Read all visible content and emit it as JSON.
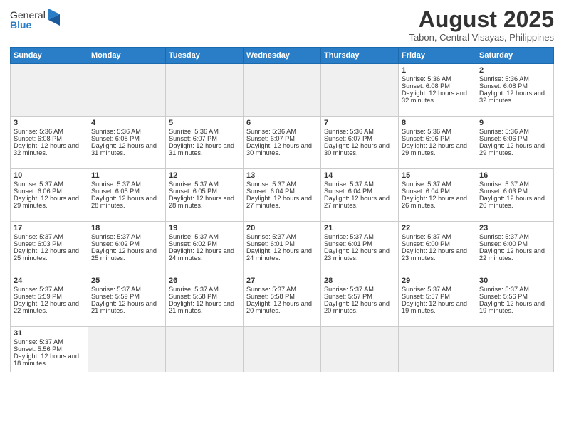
{
  "header": {
    "logo_general": "General",
    "logo_blue": "Blue",
    "month_title": "August 2025",
    "location": "Tabon, Central Visayas, Philippines"
  },
  "days_of_week": [
    "Sunday",
    "Monday",
    "Tuesday",
    "Wednesday",
    "Thursday",
    "Friday",
    "Saturday"
  ],
  "weeks": [
    [
      {
        "day": "",
        "info": "",
        "empty": true
      },
      {
        "day": "",
        "info": "",
        "empty": true
      },
      {
        "day": "",
        "info": "",
        "empty": true
      },
      {
        "day": "",
        "info": "",
        "empty": true
      },
      {
        "day": "",
        "info": "",
        "empty": true
      },
      {
        "day": "1",
        "info": "Sunrise: 5:36 AM\nSunset: 6:08 PM\nDaylight: 12 hours and 32 minutes."
      },
      {
        "day": "2",
        "info": "Sunrise: 5:36 AM\nSunset: 6:08 PM\nDaylight: 12 hours and 32 minutes."
      }
    ],
    [
      {
        "day": "3",
        "info": "Sunrise: 5:36 AM\nSunset: 6:08 PM\nDaylight: 12 hours and 32 minutes."
      },
      {
        "day": "4",
        "info": "Sunrise: 5:36 AM\nSunset: 6:08 PM\nDaylight: 12 hours and 31 minutes."
      },
      {
        "day": "5",
        "info": "Sunrise: 5:36 AM\nSunset: 6:07 PM\nDaylight: 12 hours and 31 minutes."
      },
      {
        "day": "6",
        "info": "Sunrise: 5:36 AM\nSunset: 6:07 PM\nDaylight: 12 hours and 30 minutes."
      },
      {
        "day": "7",
        "info": "Sunrise: 5:36 AM\nSunset: 6:07 PM\nDaylight: 12 hours and 30 minutes."
      },
      {
        "day": "8",
        "info": "Sunrise: 5:36 AM\nSunset: 6:06 PM\nDaylight: 12 hours and 29 minutes."
      },
      {
        "day": "9",
        "info": "Sunrise: 5:36 AM\nSunset: 6:06 PM\nDaylight: 12 hours and 29 minutes."
      }
    ],
    [
      {
        "day": "10",
        "info": "Sunrise: 5:37 AM\nSunset: 6:06 PM\nDaylight: 12 hours and 29 minutes."
      },
      {
        "day": "11",
        "info": "Sunrise: 5:37 AM\nSunset: 6:05 PM\nDaylight: 12 hours and 28 minutes."
      },
      {
        "day": "12",
        "info": "Sunrise: 5:37 AM\nSunset: 6:05 PM\nDaylight: 12 hours and 28 minutes."
      },
      {
        "day": "13",
        "info": "Sunrise: 5:37 AM\nSunset: 6:04 PM\nDaylight: 12 hours and 27 minutes."
      },
      {
        "day": "14",
        "info": "Sunrise: 5:37 AM\nSunset: 6:04 PM\nDaylight: 12 hours and 27 minutes."
      },
      {
        "day": "15",
        "info": "Sunrise: 5:37 AM\nSunset: 6:04 PM\nDaylight: 12 hours and 26 minutes."
      },
      {
        "day": "16",
        "info": "Sunrise: 5:37 AM\nSunset: 6:03 PM\nDaylight: 12 hours and 26 minutes."
      }
    ],
    [
      {
        "day": "17",
        "info": "Sunrise: 5:37 AM\nSunset: 6:03 PM\nDaylight: 12 hours and 25 minutes."
      },
      {
        "day": "18",
        "info": "Sunrise: 5:37 AM\nSunset: 6:02 PM\nDaylight: 12 hours and 25 minutes."
      },
      {
        "day": "19",
        "info": "Sunrise: 5:37 AM\nSunset: 6:02 PM\nDaylight: 12 hours and 24 minutes."
      },
      {
        "day": "20",
        "info": "Sunrise: 5:37 AM\nSunset: 6:01 PM\nDaylight: 12 hours and 24 minutes."
      },
      {
        "day": "21",
        "info": "Sunrise: 5:37 AM\nSunset: 6:01 PM\nDaylight: 12 hours and 23 minutes."
      },
      {
        "day": "22",
        "info": "Sunrise: 5:37 AM\nSunset: 6:00 PM\nDaylight: 12 hours and 23 minutes."
      },
      {
        "day": "23",
        "info": "Sunrise: 5:37 AM\nSunset: 6:00 PM\nDaylight: 12 hours and 22 minutes."
      }
    ],
    [
      {
        "day": "24",
        "info": "Sunrise: 5:37 AM\nSunset: 5:59 PM\nDaylight: 12 hours and 22 minutes."
      },
      {
        "day": "25",
        "info": "Sunrise: 5:37 AM\nSunset: 5:59 PM\nDaylight: 12 hours and 21 minutes."
      },
      {
        "day": "26",
        "info": "Sunrise: 5:37 AM\nSunset: 5:58 PM\nDaylight: 12 hours and 21 minutes."
      },
      {
        "day": "27",
        "info": "Sunrise: 5:37 AM\nSunset: 5:58 PM\nDaylight: 12 hours and 20 minutes."
      },
      {
        "day": "28",
        "info": "Sunrise: 5:37 AM\nSunset: 5:57 PM\nDaylight: 12 hours and 20 minutes."
      },
      {
        "day": "29",
        "info": "Sunrise: 5:37 AM\nSunset: 5:57 PM\nDaylight: 12 hours and 19 minutes."
      },
      {
        "day": "30",
        "info": "Sunrise: 5:37 AM\nSunset: 5:56 PM\nDaylight: 12 hours and 19 minutes."
      }
    ],
    [
      {
        "day": "31",
        "info": "Sunrise: 5:37 AM\nSunset: 5:56 PM\nDaylight: 12 hours and 18 minutes."
      },
      {
        "day": "",
        "info": "",
        "empty": true
      },
      {
        "day": "",
        "info": "",
        "empty": true
      },
      {
        "day": "",
        "info": "",
        "empty": true
      },
      {
        "day": "",
        "info": "",
        "empty": true
      },
      {
        "day": "",
        "info": "",
        "empty": true
      },
      {
        "day": "",
        "info": "",
        "empty": true
      }
    ]
  ]
}
